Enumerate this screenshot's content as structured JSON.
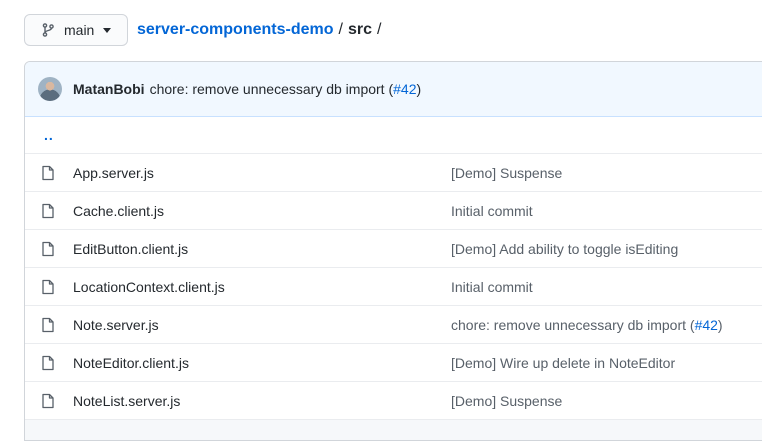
{
  "branch": {
    "name": "main",
    "icon": "git-branch-icon",
    "caret_icon": "caret-down-icon"
  },
  "breadcrumb": {
    "repo": "server-components-demo",
    "sep1": "/",
    "current": "src",
    "sep2": "/"
  },
  "latest_commit": {
    "author": "MatanBobi",
    "message": "chore: remove unnecessary db import (",
    "pr": "#42",
    "message_end": ")"
  },
  "parent_dir": "..",
  "files": [
    {
      "name": "App.server.js",
      "message": "[Demo] Suspense",
      "pr": "",
      "message_end": ""
    },
    {
      "name": "Cache.client.js",
      "message": "Initial commit",
      "pr": "",
      "message_end": ""
    },
    {
      "name": "EditButton.client.js",
      "message": "[Demo] Add ability to toggle isEditing",
      "pr": "",
      "message_end": ""
    },
    {
      "name": "LocationContext.client.js",
      "message": "Initial commit",
      "pr": "",
      "message_end": ""
    },
    {
      "name": "Note.server.js",
      "message": "chore: remove unnecessary db import (",
      "pr": "#42",
      "message_end": ")"
    },
    {
      "name": "NoteEditor.client.js",
      "message": "[Demo] Wire up delete in NoteEditor",
      "pr": "",
      "message_end": ""
    },
    {
      "name": "NoteList.server.js",
      "message": "[Demo] Suspense",
      "pr": "",
      "message_end": ""
    }
  ],
  "colors": {
    "link": "#0366d6",
    "commit_bar_bg": "#f1f8ff",
    "muted": "#586069"
  }
}
